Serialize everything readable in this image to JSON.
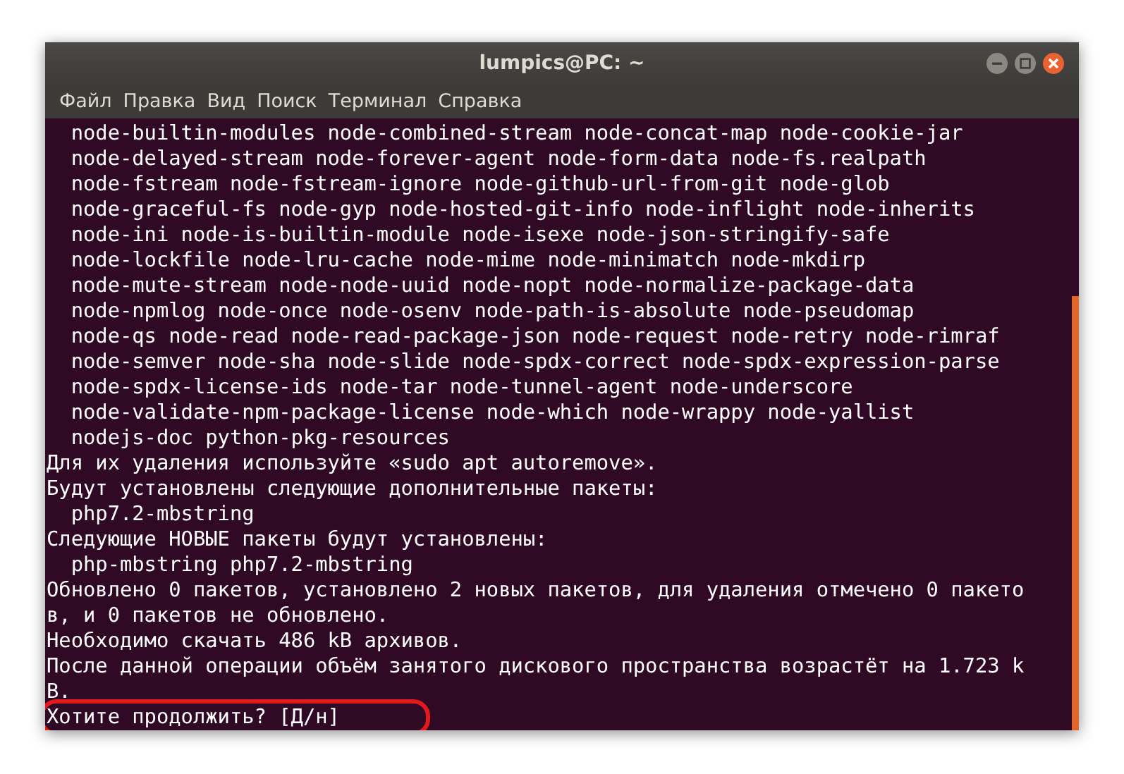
{
  "window": {
    "title": "lumpics@PC: ~"
  },
  "menu": [
    "Файл",
    "Правка",
    "Вид",
    "Поиск",
    "Терминал",
    "Справка"
  ],
  "terminal": {
    "lines": [
      {
        "text": "  node-builtin-modules node-combined-stream node-concat-map node-cookie-jar",
        "highlighted": false
      },
      {
        "text": "  node-delayed-stream node-forever-agent node-form-data node-fs.realpath",
        "highlighted": false
      },
      {
        "text": "  node-fstream node-fstream-ignore node-github-url-from-git node-glob",
        "highlighted": false
      },
      {
        "text": "  node-graceful-fs node-gyp node-hosted-git-info node-inflight node-inherits",
        "highlighted": false
      },
      {
        "text": "  node-ini node-is-builtin-module node-isexe node-json-stringify-safe",
        "highlighted": false
      },
      {
        "text": "  node-lockfile node-lru-cache node-mime node-minimatch node-mkdirp",
        "highlighted": false
      },
      {
        "text": "  node-mute-stream node-node-uuid node-nopt node-normalize-package-data",
        "highlighted": false
      },
      {
        "text": "  node-npmlog node-once node-osenv node-path-is-absolute node-pseudomap",
        "highlighted": false
      },
      {
        "text": "  node-qs node-read node-read-package-json node-request node-retry node-rimraf",
        "highlighted": false
      },
      {
        "text": "  node-semver node-sha node-slide node-spdx-correct node-spdx-expression-parse",
        "highlighted": false
      },
      {
        "text": "  node-spdx-license-ids node-tar node-tunnel-agent node-underscore",
        "highlighted": false
      },
      {
        "text": "  node-validate-npm-package-license node-which node-wrappy node-yallist",
        "highlighted": false
      },
      {
        "text": "  nodejs-doc python-pkg-resources",
        "highlighted": false
      },
      {
        "text": "Для их удаления используйте «sudo apt autoremove».",
        "highlighted": false
      },
      {
        "text": "Будут установлены следующие дополнительные пакеты:",
        "highlighted": false
      },
      {
        "text": "  php7.2-mbstring",
        "highlighted": false
      },
      {
        "text": "Следующие НОВЫЕ пакеты будут установлены:",
        "highlighted": false
      },
      {
        "text": "  php-mbstring php7.2-mbstring",
        "highlighted": false
      },
      {
        "text": "Обновлено 0 пакетов, установлено 2 новых пакетов, для удаления отмечено 0 пакето",
        "highlighted": false
      },
      {
        "text": "в, и 0 пакетов не обновлено.",
        "highlighted": false
      },
      {
        "text": "Необходимо скачать 486 kB архивов.",
        "highlighted": false
      },
      {
        "text": "После данной операции объём занятого дискового пространства возрастёт на 1.723 k",
        "highlighted": false
      },
      {
        "text": "B.",
        "highlighted": false
      },
      {
        "text": "Хотите продолжить? [Д/н]",
        "highlighted": true
      }
    ]
  }
}
